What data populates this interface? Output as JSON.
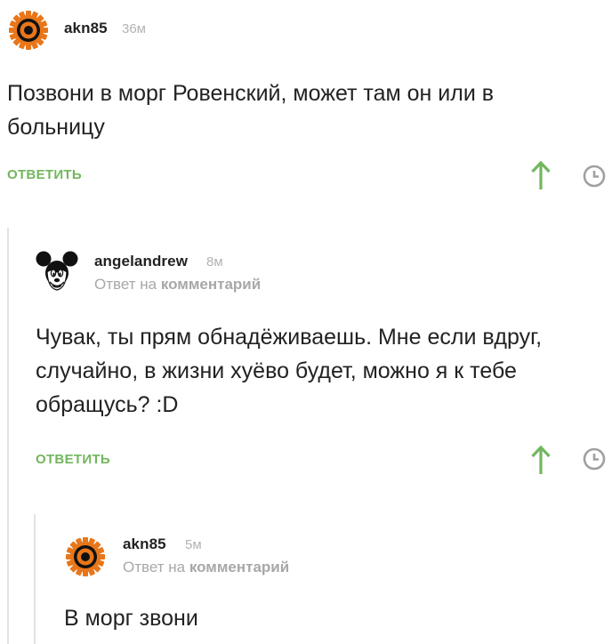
{
  "comments": [
    {
      "user": "akn85",
      "time": "36м",
      "reply_to_prefix": "",
      "reply_to_target": "",
      "text_lines": [
        "Позвони в морг Ровенский, может там он или в",
        "больницу"
      ],
      "reply_label": "ОТВЕТИТЬ",
      "avatar": "gear-avatar"
    },
    {
      "user": "angelandrew",
      "time": "8м",
      "reply_to_prefix": "Ответ на",
      "reply_to_target": "комментарий",
      "text_lines": [
        "Чувак, ты прям обнадёживаешь. Мне если вдруг,",
        "случайно, в жизни хуёво будет, можно я к тебе",
        "обращусь? :D"
      ],
      "reply_label": "ОТВЕТИТЬ",
      "avatar": "mouse-avatar"
    },
    {
      "user": "akn85",
      "time": "5м",
      "reply_to_prefix": "Ответ на",
      "reply_to_target": "комментарий",
      "text_lines": [
        "В морг звони"
      ],
      "reply_label": "",
      "avatar": "gear-avatar"
    }
  ],
  "colors": {
    "accent_green": "#73b65e",
    "muted_gray": "#a8a8a8"
  }
}
